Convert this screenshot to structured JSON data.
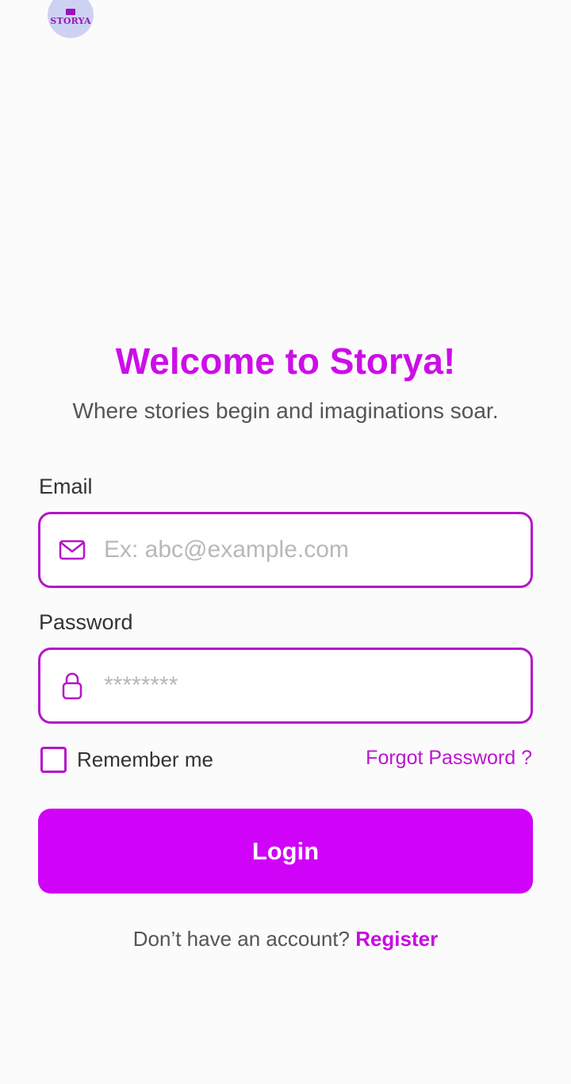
{
  "logo": {
    "text": "STORYA"
  },
  "welcome": {
    "title": "Welcome to Storya!",
    "subtitle": "Where stories begin and imaginations soar."
  },
  "email": {
    "label": "Email",
    "placeholder": "Ex: abc@example.com",
    "value": "",
    "icon": "mail-icon"
  },
  "password": {
    "label": "Password",
    "placeholder": "********",
    "value": "",
    "icon": "lock-icon"
  },
  "remember_me": {
    "label": "Remember me",
    "checked": false
  },
  "forgot_password": {
    "label": "Forgot Password ?"
  },
  "login_button": {
    "label": "Login"
  },
  "register": {
    "prompt": "Don’t have an account?",
    "link": "Register"
  },
  "colors": {
    "accent": "#d102f8",
    "title": "#cc0ee8",
    "field_border": "#b514c9",
    "logo_bg": "#cdd2f2"
  }
}
